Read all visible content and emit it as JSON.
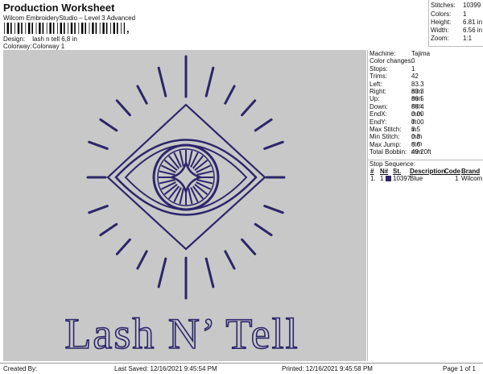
{
  "header": {
    "title": "Production Worksheet",
    "subtitle": "Wilcom EmbroideryStudio – Level 3 Advanced",
    "design_label": "Design:",
    "design_value": "lash n tell 6,8 in",
    "colorway_label": "Colorway:",
    "colorway_value": "Colorway 1"
  },
  "summary": {
    "stitches_label": "Stitches:",
    "stitches_value": "10399",
    "colors_label": "Colors:",
    "colors_value": "1",
    "height_label": "Height:",
    "height_value": "6.81 in",
    "width_label": "Width:",
    "width_value": "6.56 in",
    "zoom_label": "Zoom:",
    "zoom_value": "1:1"
  },
  "design": {
    "text": "Lash N’ Tell",
    "thread_color": "#2c266a",
    "background_color": "#c8c8c8"
  },
  "machine": [
    {
      "label": "Machine:",
      "value": "Tajima"
    },
    {
      "label": "Color changes:",
      "value": "0"
    },
    {
      "label": "Stops:",
      "value": "1"
    },
    {
      "label": "Trims:",
      "value": "42"
    },
    {
      "label": "Left:",
      "value": "83.3 mm"
    },
    {
      "label": "Right:",
      "value": "83.3 mm"
    },
    {
      "label": "Up:",
      "value": "86.5 mm"
    },
    {
      "label": "Down:",
      "value": "86.4 mm"
    },
    {
      "label": "EndX:",
      "value": "0.00 in"
    },
    {
      "label": "EndY:",
      "value": "0.00 in"
    },
    {
      "label": "Max Stitch:",
      "value": "6.5 mm"
    },
    {
      "label": "Min Stitch:",
      "value": "0.3 mm"
    },
    {
      "label": "Max Jump:",
      "value": "6.6 mm"
    },
    {
      "label": "Total Bobbin:",
      "value": "49.20ft"
    }
  ],
  "stop_sequence": {
    "heading": "Stop Sequence:",
    "columns": [
      "#",
      "N#",
      "St.",
      "Description",
      "Code",
      "Brand"
    ],
    "rows": [
      {
        "num": "1.",
        "n": "1",
        "stitches": "10397",
        "description": "Blue",
        "code": "1",
        "brand": "Wilcom",
        "color": "#2c266a"
      }
    ]
  },
  "footer": {
    "created": "Created By:",
    "saved": "Last Saved: 12/16/2021 9:45:54 PM",
    "printed": "Printed: 12/16/2021 9:45:58 PM",
    "page": "Page 1 of 1"
  }
}
